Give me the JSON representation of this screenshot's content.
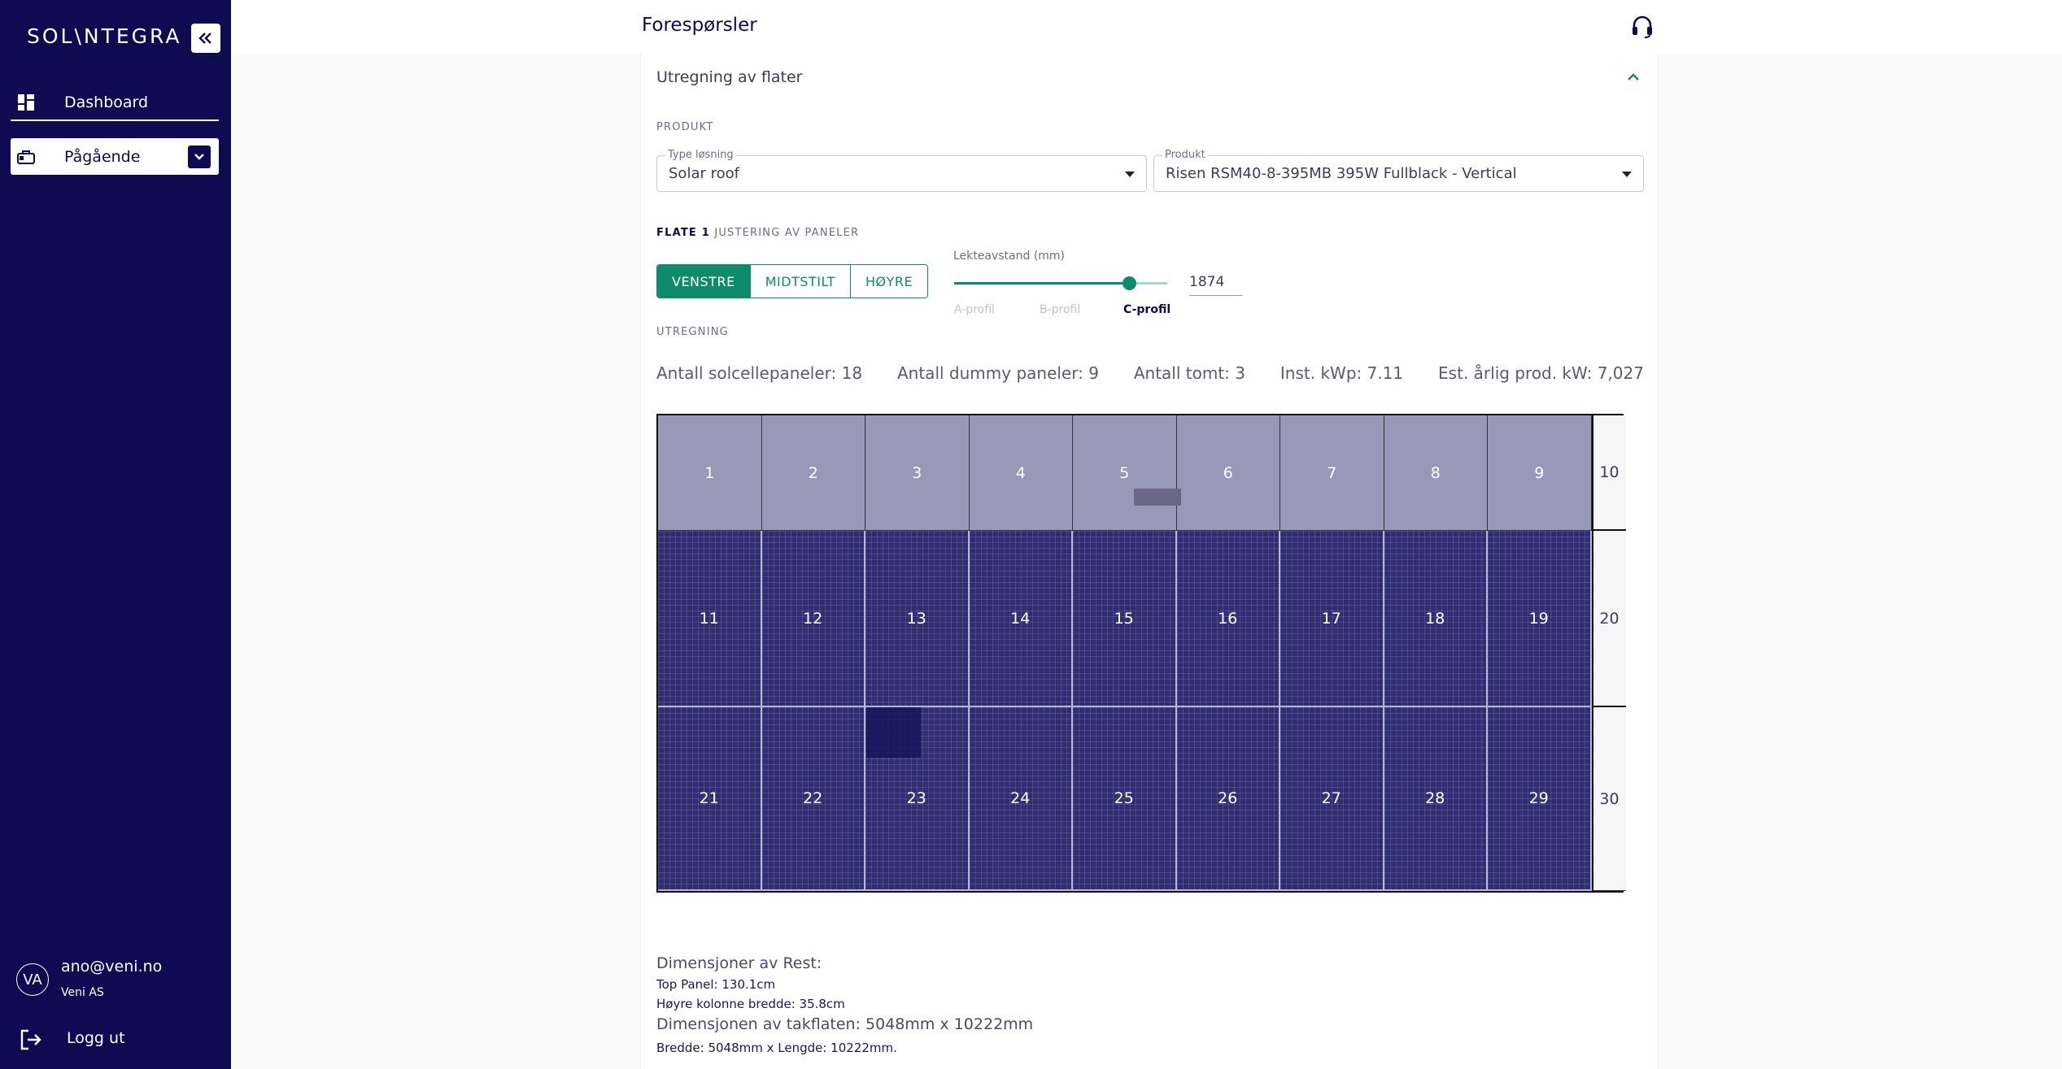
{
  "sidebar": {
    "logo": "SOL\\NTEGRA",
    "nav": [
      {
        "label": "Dashboard",
        "icon": "dashboard-icon"
      },
      {
        "label": "Pågående",
        "icon": "briefcase-icon"
      }
    ],
    "user": {
      "initials": "VA",
      "email": "ano@veni.no",
      "company": "Veni AS"
    },
    "logout_label": "Logg ut"
  },
  "header": {
    "title": "Forespørsler"
  },
  "section": {
    "title": "Utregning av flater",
    "product_overline": "PRODUKT",
    "type_field": {
      "label": "Type løsning",
      "value": "Solar roof"
    },
    "product_field": {
      "label": "Produkt",
      "value": "Risen RSM40-8-395MB 395W Fullblack - Vertical"
    },
    "flate_title": "FLATE 1",
    "flate_subtitle": "JUSTERING AV PANELER",
    "alignment": {
      "options": [
        "VENSTRE",
        "MIDTSTILT",
        "HØYRE"
      ],
      "selected": "VENSTRE"
    },
    "slider": {
      "label": "Lekteavstand (mm)",
      "marks": [
        "A-profil",
        "B-profil",
        "C-profil"
      ],
      "selected_mark": "C-profil",
      "value": "1874",
      "fraction": 0.82
    },
    "calc_overline": "UTREGNING",
    "stats": [
      "Antall solcellepaneler: 18",
      "Antall dummy paneler: 9",
      "Antall tomt: 3",
      "Inst. kWp: 7.11",
      "Est. årlig prod. kW: 7,027"
    ]
  },
  "grid": {
    "rows": [
      {
        "type": "dummy",
        "cells": [
          "1",
          "2",
          "3",
          "4",
          "5",
          "6",
          "7",
          "8",
          "9"
        ],
        "end": "10"
      },
      {
        "type": "solar",
        "cells": [
          "11",
          "12",
          "13",
          "14",
          "15",
          "16",
          "17",
          "18",
          "19"
        ],
        "end": "20"
      },
      {
        "type": "solar",
        "cells": [
          "21",
          "22",
          "23",
          "24",
          "25",
          "26",
          "27",
          "28",
          "29"
        ],
        "end": "30"
      }
    ]
  },
  "dimensions": {
    "rest_title": "Dimensjoner av Rest:",
    "top_panel": "Top Panel: 130.1cm",
    "right_column": "Høyre kolonne bredde: 35.8cm",
    "roof_title": "Dimensjonen av takflaten: 5048mm x 10222mm",
    "roof_detail": "Bredde: 5048mm x Lengde: 10222mm."
  },
  "colors": {
    "sidebar": "#0e0b52",
    "accent": "#0e8a6c",
    "dummy_panel": "#9a98b8",
    "solar_panel": "#302e72"
  }
}
